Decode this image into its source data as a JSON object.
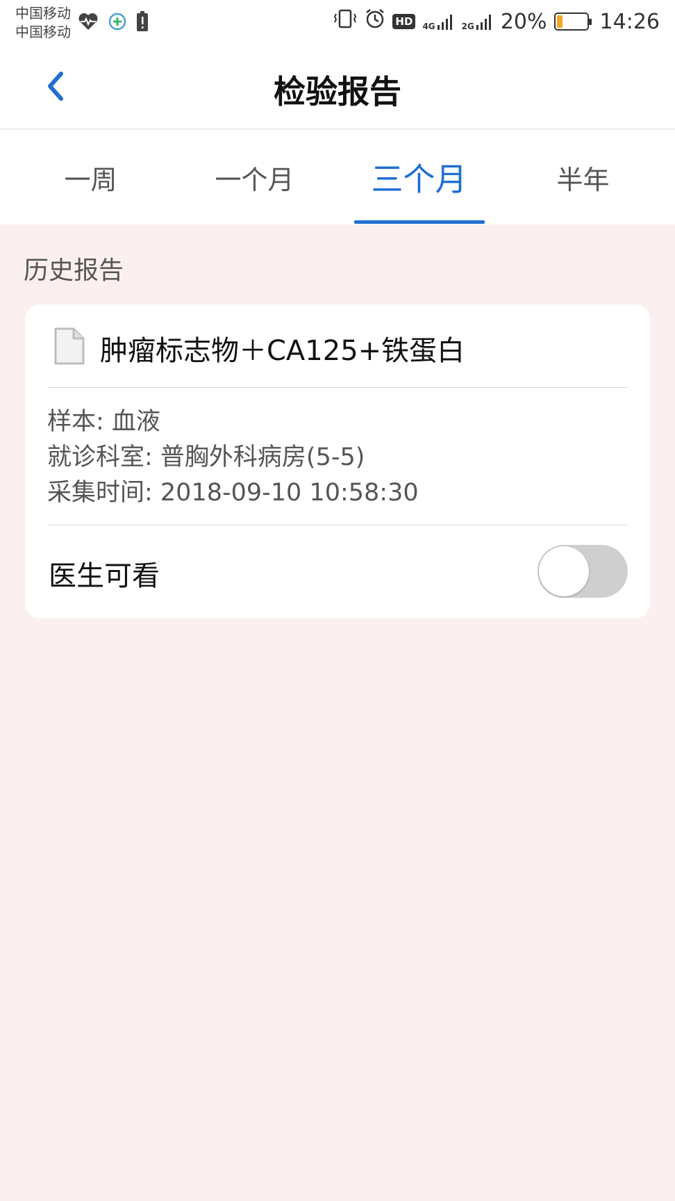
{
  "status_bar": {
    "carrier_1": "中国移动",
    "carrier_2": "中国移动",
    "network_1": "4G",
    "network_2": "2G",
    "battery_percent": "20%",
    "battery_level": 0.2,
    "time": "14:26",
    "hd_label": "HD",
    "icons": [
      "heartbeat-icon",
      "app-notification-icon",
      "battery-alert-icon",
      "vibrate-icon",
      "alarm-icon",
      "hd-icon",
      "signal-4g-icon",
      "signal-2g-icon",
      "battery-icon"
    ]
  },
  "header": {
    "title": "检验报告",
    "back_icon": "chevron-left-icon"
  },
  "tabs": [
    {
      "label": "一周",
      "active": false
    },
    {
      "label": "一个月",
      "active": false
    },
    {
      "label": "三个月",
      "active": true
    },
    {
      "label": "半年",
      "active": false
    }
  ],
  "section_label": "历史报告",
  "report": {
    "name": "肿瘤标志物＋CA125+铁蛋白",
    "icon": "document-icon",
    "sample": "样本:  血液",
    "department": "就诊科室:  普胸外科病房(5-5)",
    "collected": "采集时间:  2018-09-10 10:58:30",
    "doctor_visible_label": "医生可看",
    "doctor_visible": false
  },
  "colors": {
    "accent": "#1f6fd1",
    "background": "#fbf0ef",
    "toggle_off": "#cfcfcf",
    "battery_fill": "#f5a623"
  }
}
